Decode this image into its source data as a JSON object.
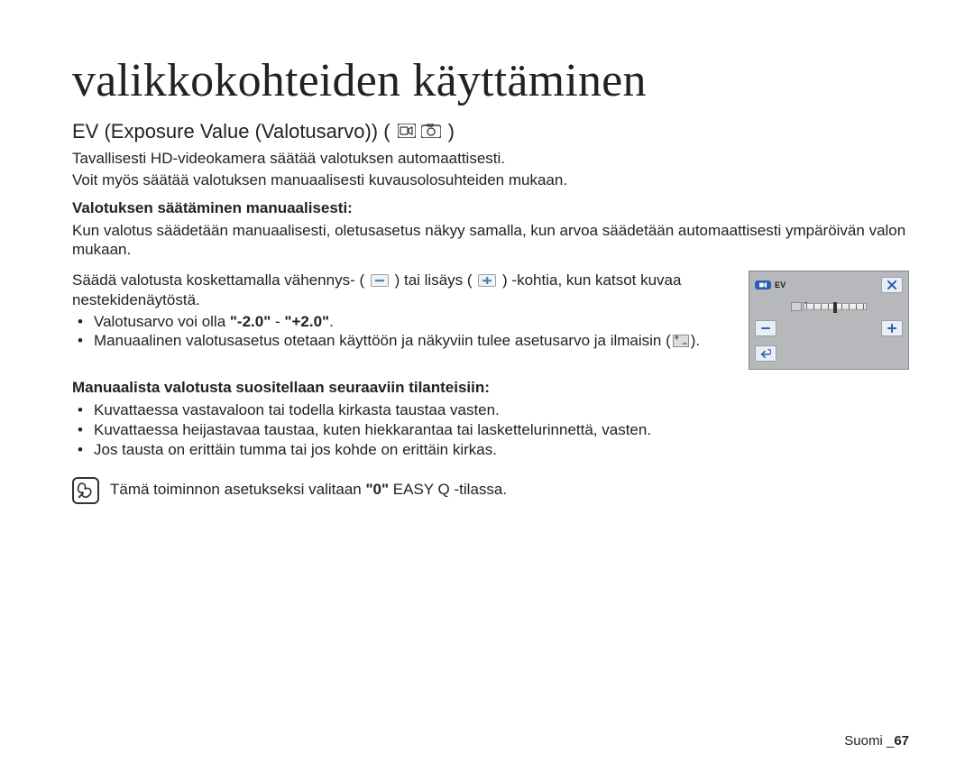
{
  "title": "valikkokohteiden käyttäminen",
  "section": {
    "heading": "EV (Exposure Value (Valotusarvo)) (",
    "heading_close": ")",
    "intro1": "Tavallisesti HD-videokamera säätää valotuksen automaattisesti.",
    "intro2": "Voit myös säätää valotuksen manuaalisesti kuvausolosuhteiden mukaan.",
    "sub1": "Valotuksen säätäminen manuaalisesti:",
    "p1": "Kun valotus säädetään manuaalisesti, oletusasetus näkyy samalla, kun arvoa säädetään automaattisesti ympäröivän valon mukaan.",
    "p2a": "Säädä valotusta koskettamalla vähennys- (",
    "p2b": ") tai lisäys (",
    "p2c": ") -kohtia, kun katsot kuvaa nestekidenäytöstä.",
    "b1a": "Valotusarvo voi olla ",
    "b1b": "\"-2.0\"",
    "b1c": " - ",
    "b1d": "\"+2.0\"",
    "b1e": ".",
    "b2a": "Manuaalinen valotusasetus otetaan käyttöön ja näkyviin tulee asetusarvo ja ilmaisin (",
    "b2b": ").",
    "sub2": "Manuaalista valotusta suositellaan seuraaviin tilanteisiin:",
    "s1": "Kuvattaessa vastavaloon tai todella kirkasta taustaa vasten.",
    "s2": "Kuvattaessa heijastavaa taustaa, kuten hiekkarantaa tai laskettelurinnettä, vasten.",
    "s3": "Jos tausta on erittäin tumma tai jos kohde on erittäin kirkas.",
    "note_a": "Tämä toiminnon asetukseksi valitaan ",
    "note_b": "\"0\"",
    "note_c": " EASY Q -tilassa."
  },
  "lcd": {
    "ev_label": "EV",
    "ev_value": "0"
  },
  "footer": {
    "lang": "Suomi _",
    "page": "67"
  }
}
